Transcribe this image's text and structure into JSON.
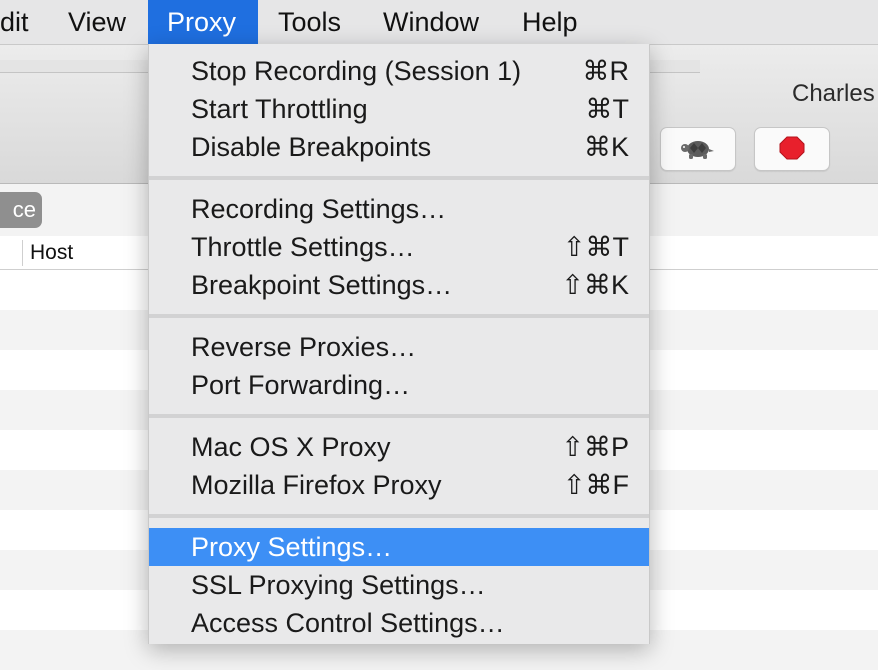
{
  "menubar": {
    "items": [
      {
        "label": "dit"
      },
      {
        "label": "View"
      },
      {
        "label": "Proxy",
        "active": true
      },
      {
        "label": "Tools"
      },
      {
        "label": "Window"
      },
      {
        "label": "Help"
      }
    ]
  },
  "window": {
    "title": "Charles",
    "toolbar": [
      {
        "icon": "turtle-icon"
      },
      {
        "icon": "stop-sign-icon"
      }
    ]
  },
  "filter": {
    "segment_label": "ce"
  },
  "table": {
    "columns": [
      "Host"
    ]
  },
  "proxy_menu": {
    "items": [
      {
        "label": "Stop Recording (Session 1)",
        "shortcut": "⌘R"
      },
      {
        "label": "Start Throttling",
        "shortcut": "⌘T"
      },
      {
        "label": "Disable Breakpoints",
        "shortcut": "⌘K"
      },
      {
        "label": "Recording Settings…",
        "shortcut": ""
      },
      {
        "label": "Throttle Settings…",
        "shortcut": "⇧⌘T"
      },
      {
        "label": "Breakpoint Settings…",
        "shortcut": "⇧⌘K"
      },
      {
        "label": "Reverse Proxies…",
        "shortcut": ""
      },
      {
        "label": "Port Forwarding…",
        "shortcut": ""
      },
      {
        "label": "Mac OS X Proxy",
        "shortcut": "⇧⌘P"
      },
      {
        "label": "Mozilla Firefox Proxy",
        "shortcut": "⇧⌘F"
      },
      {
        "label": "Proxy Settings…",
        "shortcut": "",
        "highlighted": true
      },
      {
        "label": "SSL Proxying Settings…",
        "shortcut": ""
      },
      {
        "label": "Access Control Settings…",
        "shortcut": ""
      }
    ]
  },
  "colors": {
    "menubar_active": "#1f6fe0",
    "menu_highlight": "#3d8ff5",
    "stop_sign": "#e8202c"
  }
}
